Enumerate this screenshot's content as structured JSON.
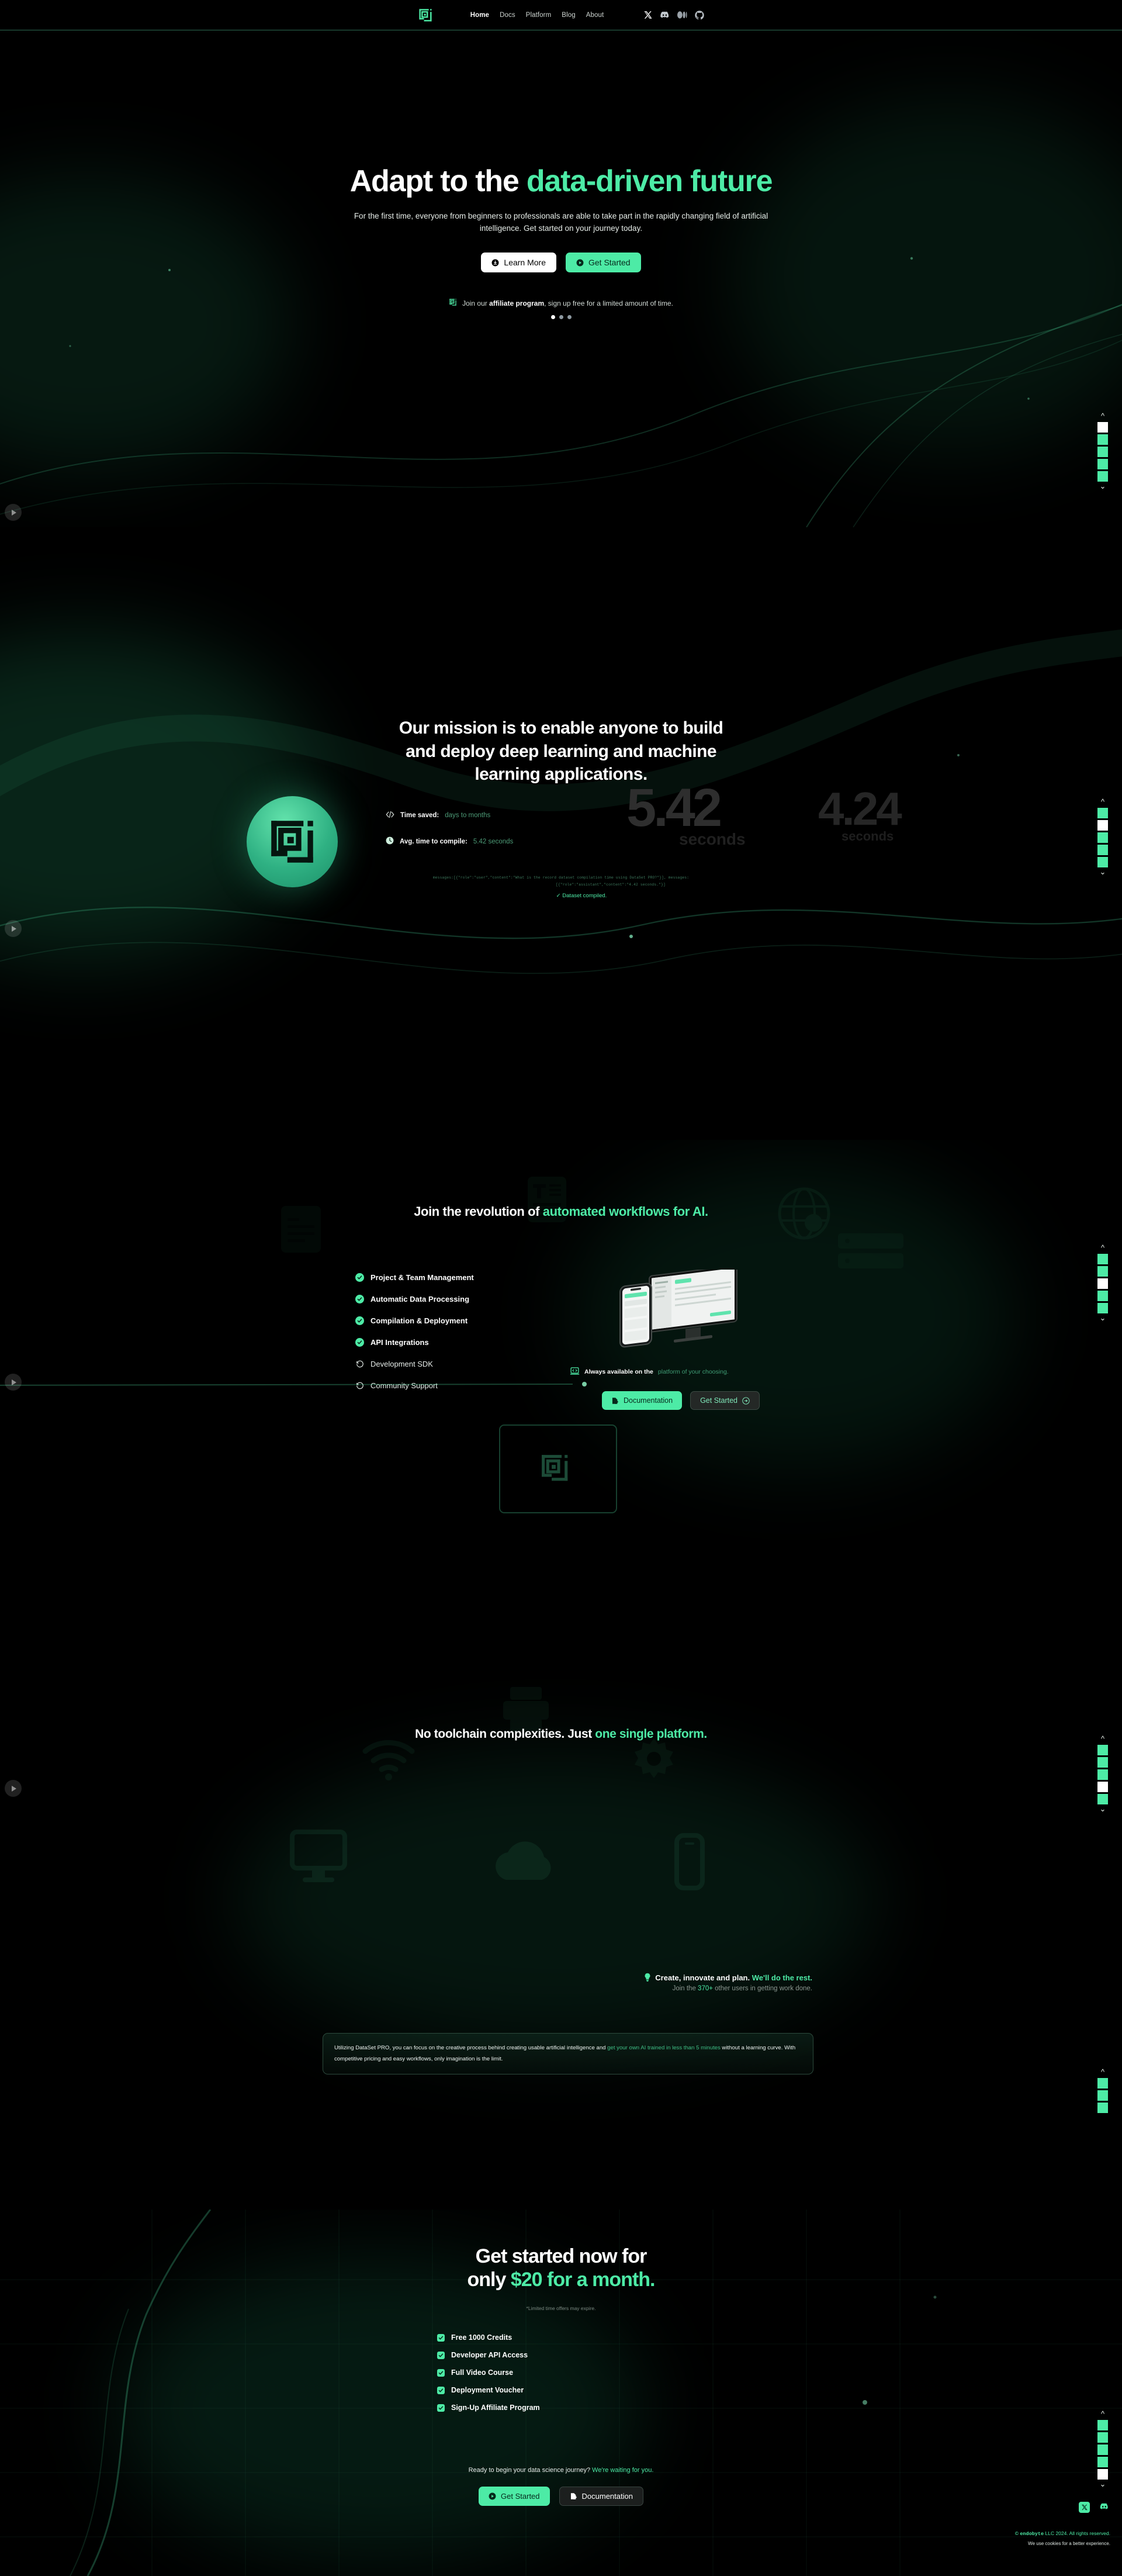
{
  "nav": {
    "logo_icon": "endobyte-logo-icon",
    "links": [
      {
        "label": "Home",
        "active": true
      },
      {
        "label": "Docs",
        "active": false
      },
      {
        "label": "Platform",
        "active": false
      },
      {
        "label": "Blog",
        "active": false
      },
      {
        "label": "About",
        "active": false
      }
    ],
    "socials": [
      {
        "name": "x-twitter-icon"
      },
      {
        "name": "discord-icon"
      },
      {
        "name": "medium-icon"
      },
      {
        "name": "github-icon"
      }
    ]
  },
  "hero": {
    "title_white": "Adapt to the ",
    "title_accent": "data-driven future",
    "subtitle": "For the first time, everyone from beginners to professionals are able to take part in the rapidly changing field of artificial intelligence. Get started on your journey today.",
    "btn_learn": "Learn More",
    "btn_started": "Get Started",
    "affiliate_pre": "Join our ",
    "affiliate_bold": "affiliate program",
    "affiliate_post": ", sign up free for a limited amount of time.",
    "carousel_active": 0,
    "carousel_count": 3
  },
  "mission": {
    "title": "Our mission is to enable anyone to build and deploy deep learning and machine learning applications.",
    "stats": [
      {
        "icon": "code-icon",
        "label": "Time saved:",
        "value": "days to months"
      },
      {
        "icon": "clock-icon",
        "label": "Avg. time to compile:",
        "value": "5.42 seconds"
      }
    ],
    "bignum_1": "5.42",
    "bignum_1_unit": "seconds",
    "bignum_2": "4.24",
    "bignum_2_unit": "seconds",
    "code_line_1": "messages:[{\"role\":\"user\",\"content\":\"What is the record dataset compilation time using DataSet PRO?\"}], messages:",
    "code_line_2": "[{\"role\":\"assistant\",\"content\":\"4.42 seconds.\"}]",
    "compiled": "Dataset compiled."
  },
  "revolution": {
    "title_white": "Join the revolution of ",
    "title_accent": "automated workflows for AI.",
    "features": [
      {
        "label": "Project & Team Management",
        "done": true
      },
      {
        "label": "Automatic Data Processing",
        "done": true
      },
      {
        "label": "Compilation & Deployment",
        "done": true
      },
      {
        "label": "API Integrations",
        "done": true
      },
      {
        "label": "Development SDK",
        "done": false
      },
      {
        "label": "Community Support",
        "done": false
      }
    ],
    "avail_white": "Always available on the ",
    "avail_green": "platform of your choosing.",
    "btn_docs": "Documentation",
    "btn_started": "Get Started"
  },
  "toolchain": {
    "title_white": "No toolchain complexities. Just ",
    "title_accent": "one single platform.",
    "cta_white": "Create, innovate and plan. ",
    "cta_accent": "We'll do the rest.",
    "sub_pre": "Join the ",
    "sub_count": "370+",
    "sub_post": " other users in getting work done.",
    "quote_p1": "Utilizing DataSet PRO, you can focus on the creative process behind creating usable artificial intelligence and ",
    "quote_g1": "get your own AI trained in less than 5 minutes",
    "quote_p2": " without a learning curve. With competitive pricing and easy workflows, only imagination is the limit."
  },
  "pricing": {
    "title_l1_white": "Get started now for",
    "title_l2_white": "only ",
    "title_l2_accent": "$20 for a month.",
    "note": "*Limited time offers may expire.",
    "items": [
      "Free 1000 Credits",
      "Developer API Access",
      "Full Video Course",
      "Deployment Voucher",
      "Sign-Up Affiliate Program"
    ],
    "ready_white": "Ready to begin your data science journey? ",
    "ready_accent": "We're waiting for you.",
    "btn_started": "Get Started",
    "btn_docs": "Documentation"
  },
  "footer": {
    "socials": [
      {
        "name": "x-twitter-icon"
      },
      {
        "name": "discord-icon"
      }
    ],
    "copyright_brand": "endobyte",
    "copyright_rest": " LLC 2024. All rights reserved.",
    "cookie": "We use cookies for a better experience."
  },
  "rails": [
    {
      "active_index": 0,
      "count": 5
    },
    {
      "active_index": 1,
      "count": 5
    },
    {
      "active_index": 2,
      "count": 5
    },
    {
      "active_index": 3,
      "count": 5
    },
    {
      "active_index": 4,
      "count": 5
    }
  ],
  "colors": {
    "accent": "#4DEBA6",
    "accent_dim": "#3f9c74",
    "background": "#000000"
  }
}
